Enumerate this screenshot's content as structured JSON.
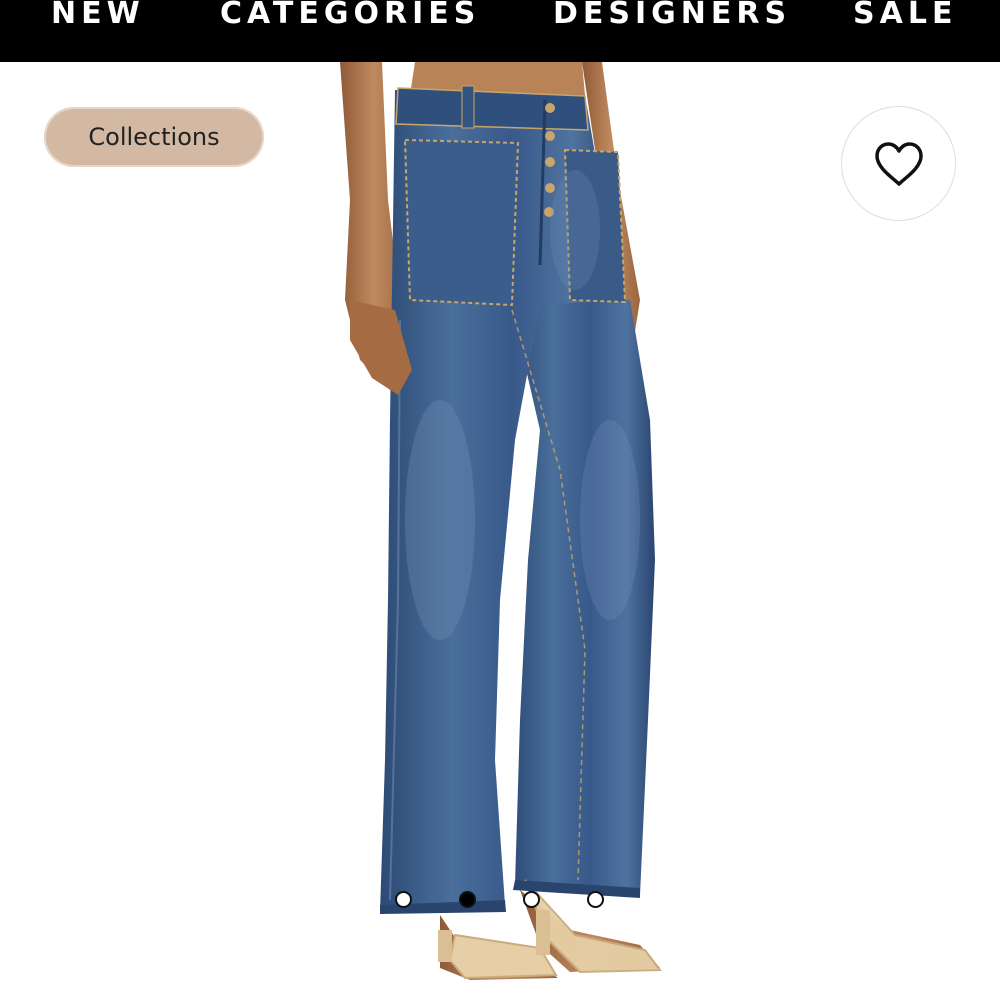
{
  "nav": {
    "items": [
      {
        "label": "NEW"
      },
      {
        "label": "CATEGORIES"
      },
      {
        "label": "DESIGNERS"
      },
      {
        "label": "SALE"
      }
    ]
  },
  "collections_button": {
    "label": "Collections",
    "color": "#d3b9a3"
  },
  "wishlist": {
    "icon": "heart-outline-icon"
  },
  "carousel": {
    "total": 4,
    "active_index": 1
  },
  "colors": {
    "navbar": "#000000",
    "denim": "#3c5f8c",
    "sandal": "#e6cfa6",
    "skin": "#b0784f"
  }
}
